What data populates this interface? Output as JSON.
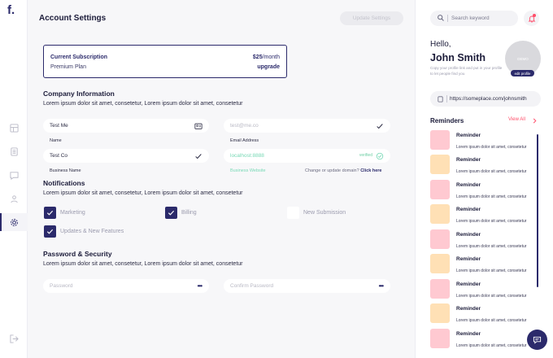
{
  "brand": {
    "logo_text": "f.",
    "primary_color": "#2b2a6b",
    "accent_color": "#ff4e6a",
    "success_color": "#79d9b6"
  },
  "sidebar": {
    "icons": [
      "dashboard-icon",
      "document-icon",
      "chat-icon",
      "users-icon",
      "settings-icon"
    ],
    "active": "settings-icon",
    "logout_icon": "logout-icon"
  },
  "header": {
    "title": "Account Settings",
    "update_button": "Update Settings"
  },
  "subscription": {
    "title": "Current Subscription",
    "plan": "Premium Plan",
    "price": "$25",
    "period": "/month",
    "upgrade_label": "upgrade"
  },
  "company": {
    "title": "Company Information",
    "description": "Lorem ipsum dolor sit amet, consetetur, Lorem ipsum dolor sit amet, consetetur",
    "name_value": "Test Me",
    "name_label": "Name",
    "email_placeholder": "test@me.co",
    "email_label": "Email Address",
    "business_value": "Test Co",
    "business_label": "Business Name",
    "website_placeholder": "localhost:8888",
    "website_status": "verified",
    "website_label": "Business Website",
    "domain_note": "Change or update domain?",
    "domain_link": "Click here"
  },
  "notifications": {
    "title": "Notifications",
    "description": "Lorem ipsum dolor sit amet, consetetur, Lorem ipsum dolor sit amet, consetetur",
    "options": [
      {
        "label": "Marketing",
        "checked": true
      },
      {
        "label": "Billing",
        "checked": true
      },
      {
        "label": "New Submission",
        "checked": false
      },
      {
        "label": "Updates & New Features",
        "checked": true
      }
    ]
  },
  "security": {
    "title": "Password & Security",
    "description": "Lorem ipsum dolor sit amet, consetetur, Lorem ipsum dolor sit amet, consetetur",
    "password_placeholder": "Password",
    "confirm_placeholder": "Confirm Password",
    "masked": "•••"
  },
  "right_panel": {
    "search_placeholder": "Search keyword",
    "greeting": "Hello,",
    "user_name": "John Smith",
    "profile_hint": "Copy your profile link and put in your profile to let people find you",
    "avatar_text": "DEMO",
    "edit_profile": "edit profile",
    "profile_url": "https://someplace.com/johnsmith",
    "reminders_title": "Reminders",
    "view_all": "View All",
    "reminders": [
      {
        "title": "Reminder",
        "text": "Lorem ipsum dolor sit amet, consetetur",
        "color": "#ffc9d1"
      },
      {
        "title": "Reminder",
        "text": "Lorem ipsum dolor sit amet, consetetur",
        "color": "#ffe0b5"
      },
      {
        "title": "Reminder",
        "text": "Lorem ipsum dolor sit amet, consetetur",
        "color": "#ffc9d1"
      },
      {
        "title": "Reminder",
        "text": "Lorem ipsum dolor sit amet, consetetur",
        "color": "#ffe0b5"
      },
      {
        "title": "Reminder",
        "text": "Lorem ipsum dolor sit amet, consetetur",
        "color": "#ffc9d1"
      },
      {
        "title": "Reminder",
        "text": "Lorem ipsum dolor sit amet, consetetur",
        "color": "#ffe0b5"
      },
      {
        "title": "Reminder",
        "text": "Lorem ipsum dolor sit amet, consetetur",
        "color": "#ffc9d1"
      },
      {
        "title": "Reminder",
        "text": "Lorem ipsum dolor sit amet, consetetur",
        "color": "#ffe0b5"
      },
      {
        "title": "Reminder",
        "text": "Lorem ipsum dolor sit amet, consetetur",
        "color": "#ffc9d1"
      }
    ]
  }
}
